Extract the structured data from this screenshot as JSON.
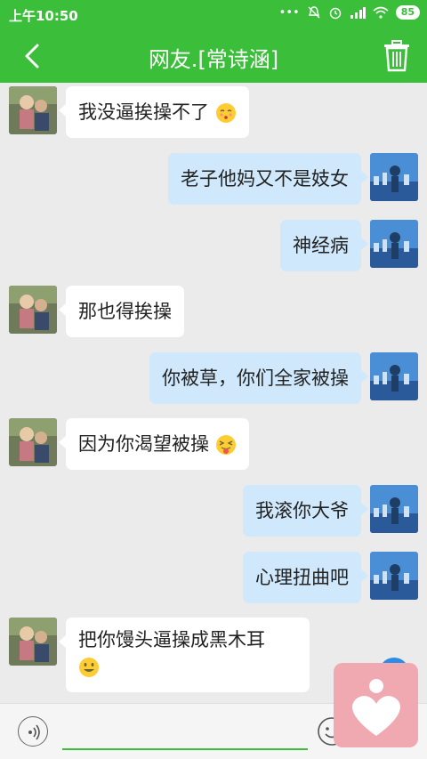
{
  "status_bar": {
    "time": "上午10:50",
    "battery": "85"
  },
  "header": {
    "title": "网友.[常诗涵]"
  },
  "messages": [
    {
      "side": "left",
      "text": "我没逼挨操不了",
      "emoji": "kissing-face"
    },
    {
      "side": "right",
      "text": "老子他妈又不是妓女"
    },
    {
      "side": "right",
      "text": "神经病"
    },
    {
      "side": "left",
      "text": "那也得挨操"
    },
    {
      "side": "right",
      "text": "你被草，你们全家被操"
    },
    {
      "side": "left",
      "text": "因为你渴望被操",
      "emoji": "tongue-out-face"
    },
    {
      "side": "right",
      "text": "我滚你大爷"
    },
    {
      "side": "right",
      "text": "心理扭曲吧"
    },
    {
      "side": "left",
      "text": "把你馒头逼操成黑木耳",
      "emoji": "smiley-face"
    }
  ],
  "input": {
    "value": ""
  },
  "colors": {
    "header_green": "#3bbf3b",
    "sent_bubble": "#cfe8fb",
    "received_bubble": "#ffffff",
    "floating_button": "#f0a8b1"
  }
}
